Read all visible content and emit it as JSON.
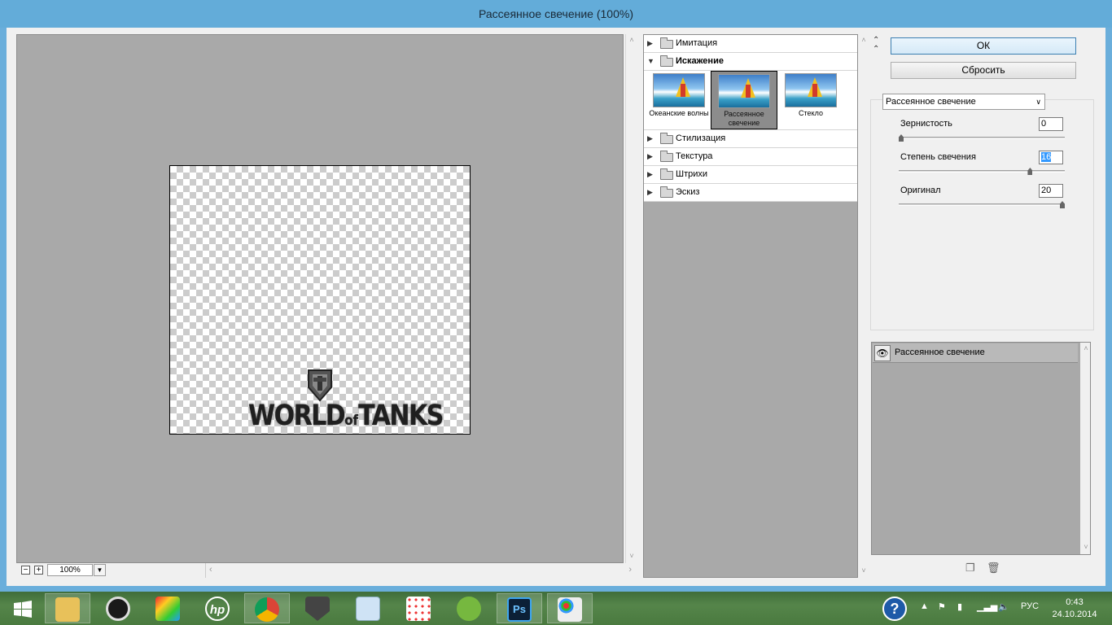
{
  "window": {
    "title": "Рассеянное свечение (100%)"
  },
  "preview": {
    "artwork_text": "WORLD",
    "artwork_of": "of",
    "artwork_text2": "TANKS",
    "zoom_minus": "−",
    "zoom_plus": "+",
    "zoom_value": "100%"
  },
  "gallery": {
    "categories": [
      {
        "label": "Имитация",
        "expanded": false
      },
      {
        "label": "Искажение",
        "expanded": true
      },
      {
        "label": "Стилизация",
        "expanded": false
      },
      {
        "label": "Текстура",
        "expanded": false
      },
      {
        "label": "Штрихи",
        "expanded": false
      },
      {
        "label": "Эскиз",
        "expanded": false
      }
    ],
    "thumbnails": [
      {
        "label": "Океанские волны",
        "selected": false
      },
      {
        "label": "Рассеянное свечение",
        "selected": true
      },
      {
        "label": "Стекло",
        "selected": false
      }
    ]
  },
  "actions": {
    "ok_label": "ОК",
    "reset_label": "Сбросить"
  },
  "settings": {
    "filter_selected": "Рассеянное свечение",
    "params": [
      {
        "label": "Зернистость",
        "value": "0",
        "slider_fraction": 0.0
      },
      {
        "label": "Степень свечения",
        "value": "16",
        "slider_fraction": 0.8
      },
      {
        "label": "Оригинал",
        "value": "20",
        "slider_fraction": 1.0
      }
    ]
  },
  "layers": {
    "items": [
      {
        "label": "Рассеянное свечение",
        "visible": true
      }
    ]
  },
  "taskbar": {
    "apps": [
      "start",
      "file-explorer",
      "media-player",
      "colorful-app",
      "hp",
      "chrome",
      "world-of-tanks",
      "monitor",
      "apps-grid",
      "utorrent",
      "photoshop",
      "paint"
    ],
    "active_app": "photoshop",
    "language": "РУС",
    "time": "0:43",
    "date": "24.10.2014",
    "photoshop_label": "Ps",
    "hp_label": "hp"
  },
  "colors": {
    "titlebar": "#63acd9",
    "preview_bg": "#a9a9a9",
    "accent": "#3c7fb1"
  }
}
